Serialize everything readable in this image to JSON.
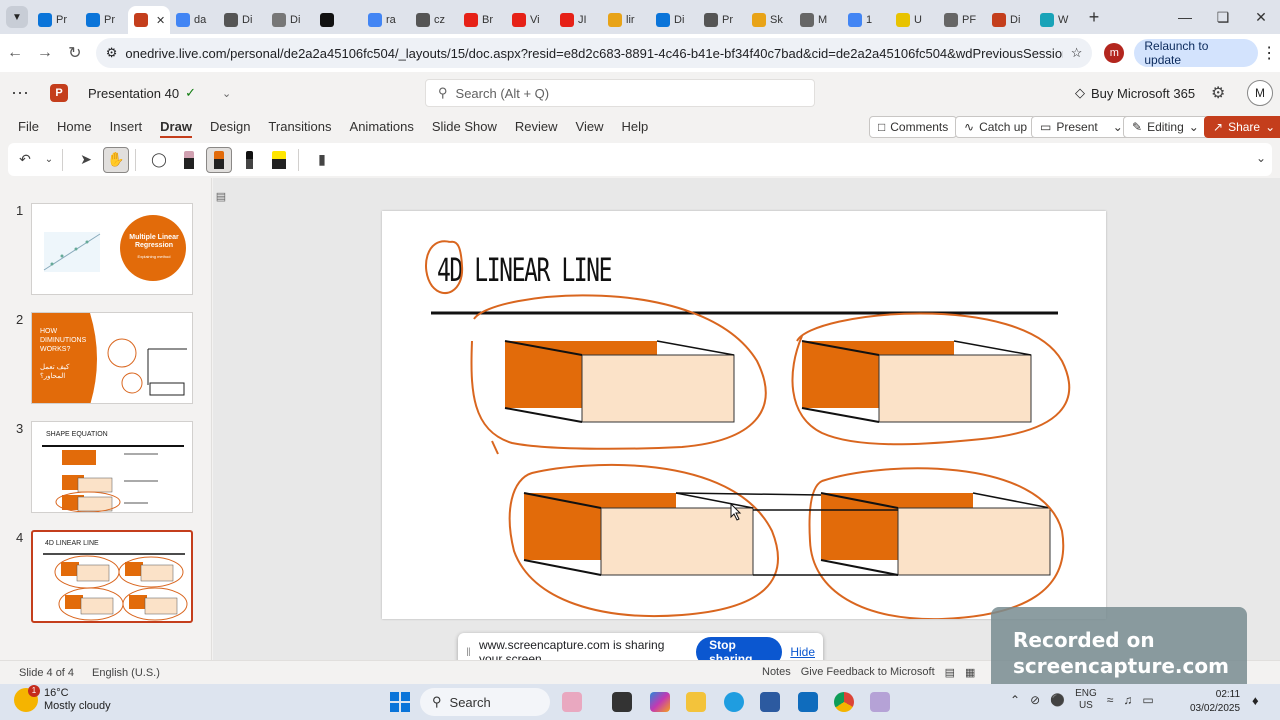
{
  "browser": {
    "tabs": [
      {
        "label": "Pr",
        "color": "#0a74d9"
      },
      {
        "label": "Pr",
        "color": "#0a74d9"
      },
      {
        "label": "",
        "color": "#c43e1c",
        "active": true
      },
      {
        "label": "da",
        "color": "#4285f4"
      },
      {
        "label": "Di",
        "color": "#555555"
      },
      {
        "label": "Di",
        "color": "#777777"
      },
      {
        "label": "",
        "color": "#111111"
      },
      {
        "label": "ra",
        "color": "#4285f4"
      },
      {
        "label": "cz",
        "color": "#555555"
      },
      {
        "label": "Br",
        "color": "#e62117"
      },
      {
        "label": "Vi",
        "color": "#e62117"
      },
      {
        "label": "JI",
        "color": "#e62117"
      },
      {
        "label": "lir",
        "color": "#e8a317"
      },
      {
        "label": "Di",
        "color": "#0a74d9"
      },
      {
        "label": "Pr",
        "color": "#555555"
      },
      {
        "label": "Sk",
        "color": "#e8a317"
      },
      {
        "label": "M",
        "color": "#666666"
      },
      {
        "label": "1",
        "color": "#4285f4"
      },
      {
        "label": "U",
        "color": "#e8c300"
      },
      {
        "label": "PF",
        "color": "#666666"
      },
      {
        "label": "Di",
        "color": "#c43e1c"
      },
      {
        "label": "W",
        "color": "#19a3b8"
      }
    ],
    "url": "onedrive.live.com/personal/de2a2a45106fc504/_layouts/15/doc.aspx?resid=e8d2c683-8891-4c46-b41e-bf34f40c7bad&cid=de2a2a45106fc504&wdPreviousSession=b3b29f6a-6444-8...",
    "profile_letter": "m",
    "relaunch_label": "Relaunch to update"
  },
  "app": {
    "doc_title": "Presentation 40",
    "search_placeholder": "Search (Alt + Q)",
    "buy_label": "Buy Microsoft 365",
    "avatar_letter": "M"
  },
  "ribbon": {
    "tabs": [
      "File",
      "Home",
      "Insert",
      "Draw",
      "Design",
      "Transitions",
      "Animations",
      "Slide Show",
      "Review",
      "View",
      "Help"
    ],
    "active_tab": "Draw",
    "comments_label": "Comments",
    "catchup_label": "Catch up",
    "present_label": "Present",
    "editing_label": "Editing",
    "share_label": "Share"
  },
  "thumbnails": [
    {
      "num": "1",
      "title": "Multiple Linear Regression",
      "subtitle": "Explaining method"
    },
    {
      "num": "2",
      "title": "HOW DIMINUTIONS WORKS?",
      "arabic": "كيف تعمل المحاور؟"
    },
    {
      "num": "3",
      "title": "SHAPE EQUATION"
    },
    {
      "num": "4",
      "title": "4D LINEAR LINE",
      "active": true
    }
  ],
  "slide": {
    "title": "4D LINEAR LINE"
  },
  "sharebar": {
    "message": "www.screencapture.com is sharing your screen.",
    "stop_label": "Stop sharing",
    "hide_label": "Hide"
  },
  "status": {
    "slide_info": "Slide 4 of 4",
    "language": "English (U.S.)",
    "notes": "Notes",
    "feedback": "Give Feedback to Microsoft"
  },
  "watermark": {
    "line1": "Recorded on",
    "line2": "screencapture.com"
  },
  "taskbar": {
    "temp": "16°C",
    "weather": "Mostly cloudy",
    "weather_badge": "1",
    "search_label": "Search",
    "lang1": "ENG",
    "lang2": "US",
    "time": "02:11",
    "date": "03/02/2025"
  },
  "colors": {
    "accent": "#c43e1c",
    "dark_orange": "#e26b0a",
    "light_peach": "#fbe2c8",
    "sketch_orange": "#d9661f"
  }
}
